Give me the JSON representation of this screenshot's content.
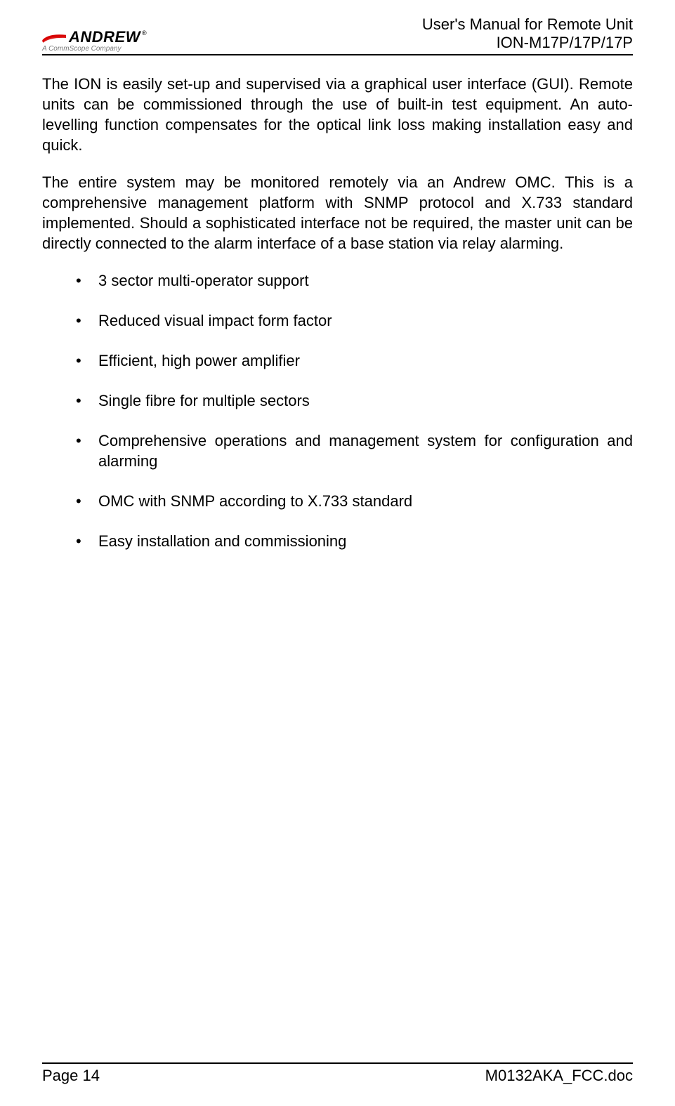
{
  "header": {
    "logo": {
      "brand": "ANDREW",
      "registered": "®",
      "tagline": "A CommScope Company"
    },
    "title_line1": "User's Manual for Remote Unit",
    "title_line2": "ION-M17P/17P/17P"
  },
  "body": {
    "para1": "The ION is easily set-up and supervised via a graphical user interface (GUI). Remote units can be commissioned through the use of built-in test equipment. An auto-levelling function compensates for the optical link loss making installation easy and quick.",
    "para2": "The entire system may be monitored remotely via an Andrew OMC. This is a comprehensive management platform with SNMP protocol and X.733 standard implemented. Should a sophisticated interface not be required, the master unit can be directly connected to the alarm interface of a base station via relay alarming.",
    "bullets": [
      "3 sector multi-operator support",
      "Reduced visual impact form factor",
      "Efficient, high power amplifier",
      "Single fibre for multiple sectors",
      "Comprehensive operations and management system for configuration and alarming",
      "OMC with SNMP according to X.733 standard",
      "Easy installation and commissioning"
    ]
  },
  "footer": {
    "page_label": "Page 14",
    "doc_name": "M0132AKA_FCC.doc"
  }
}
